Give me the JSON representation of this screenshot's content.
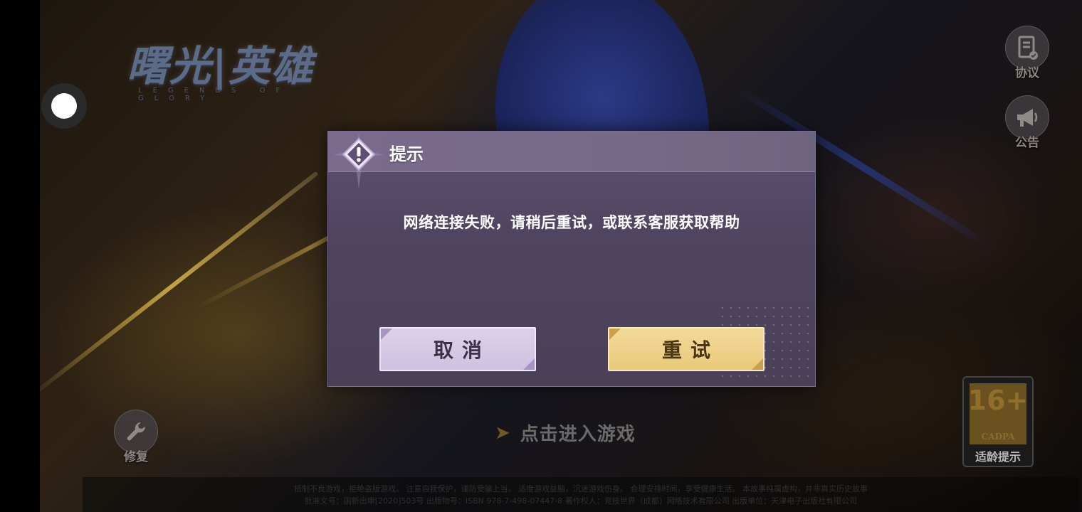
{
  "game": {
    "logo_title": "曙光|英雄",
    "logo_subtitle": "LEGENDS OF GLORY"
  },
  "side_buttons": {
    "agreement_label": "协议",
    "announcement_label": "公告",
    "repair_label": "修复"
  },
  "enter_game": {
    "label": "点击进入游戏"
  },
  "age_rating": {
    "number": "16+",
    "org": "CADPA",
    "hint": "适龄提示"
  },
  "footer": {
    "line1": "抵制不良游戏，拒绝盗版游戏。 注意自我保护，谨防受骗上当。 适度游戏益脑，沉迷游戏伤身。 合理安排时间，享受健康生活。 本故事纯属虚构，并非真实历史故事",
    "line2": "批准文号：国新出审[2020]503号 出版物号：ISBN 978-7-498-07447-8 著作权人：竞技世界（成都）网络技术有限公司 出版单位：天津电子出版社有限公司"
  },
  "dialog": {
    "title": "提示",
    "message": "网络连接失败，请稍后重试，或联系客服获取帮助",
    "cancel_label": "取消",
    "retry_label": "重试"
  },
  "colors": {
    "dialog_bg": "#4f4561",
    "dialog_header": "#7a6a8c",
    "cancel_bg": "#d6c9e6",
    "retry_bg": "#eed18a"
  }
}
